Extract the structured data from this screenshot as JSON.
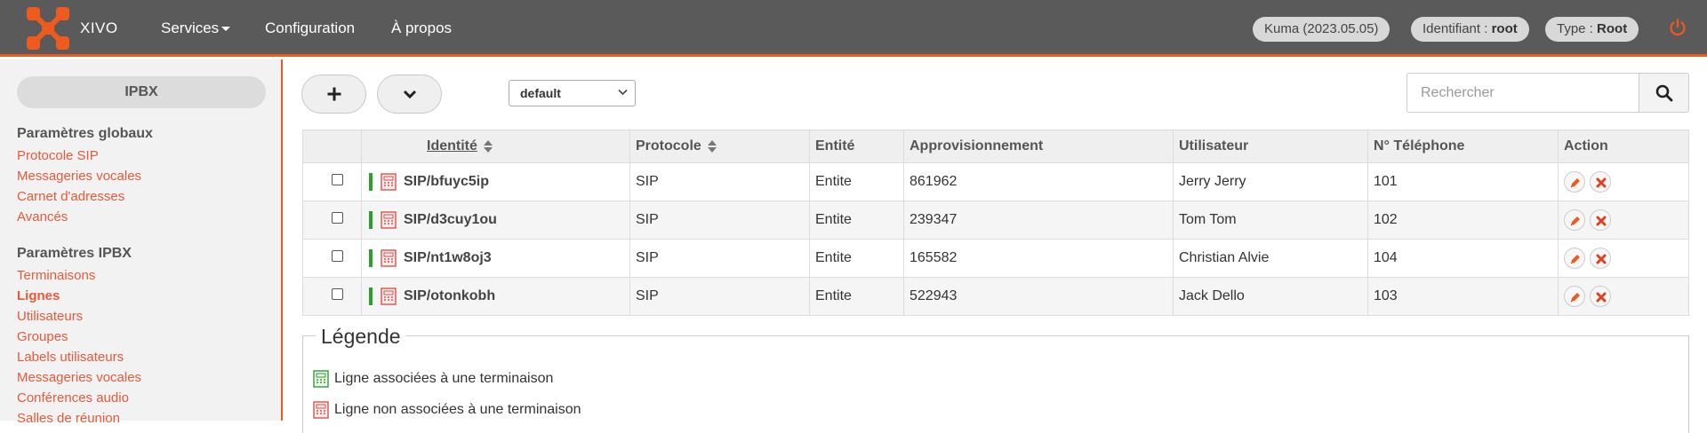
{
  "brand": "XIVO",
  "nav": {
    "services": "Services",
    "configuration": "Configuration",
    "about": "À propos"
  },
  "status": {
    "version": "Kuma (2023.05.05)",
    "login_label": "Identifiant :",
    "login_value": "root",
    "type_label": "Type :",
    "type_value": "Root"
  },
  "sidebar": {
    "title": "IPBX",
    "global_section": "Paramètres globaux",
    "global_items": [
      "Protocole SIP",
      "Messageries vocales",
      "Carnet d'adresses",
      "Avancés"
    ],
    "ipbx_section": "Paramètres IPBX",
    "ipbx_items": [
      "Terminaisons",
      "Lignes",
      "Utilisateurs",
      "Groupes",
      "Labels utilisateurs",
      "Messageries vocales",
      "Conférences audio",
      "Salles de réunion"
    ],
    "active_item": "Lignes"
  },
  "toolbar": {
    "add_icon": "plus-icon",
    "expand_icon": "chevron-down-icon",
    "context_select": "default",
    "search_placeholder": "Rechercher"
  },
  "table": {
    "headers": {
      "identity": "Identité",
      "protocol": "Protocole",
      "entity": "Entité",
      "provisioning": "Approvisionnement",
      "user": "Utilisateur",
      "phone": "N° Téléphone",
      "action": "Action"
    },
    "rows": [
      {
        "identity": "SIP/bfuyc5ip",
        "protocol": "SIP",
        "entity": "Entite",
        "provisioning": "861962",
        "user": "Jerry Jerry",
        "phone": "101"
      },
      {
        "identity": "SIP/d3cuy1ou",
        "protocol": "SIP",
        "entity": "Entite",
        "provisioning": "239347",
        "user": "Tom Tom",
        "phone": "102"
      },
      {
        "identity": "SIP/nt1w8oj3",
        "protocol": "SIP",
        "entity": "Entite",
        "provisioning": "165582",
        "user": "Christian Alvie",
        "phone": "104"
      },
      {
        "identity": "SIP/otonkobh",
        "protocol": "SIP",
        "entity": "Entite",
        "provisioning": "522943",
        "user": "Jack Dello",
        "phone": "103"
      }
    ]
  },
  "legend": {
    "title": "Légende",
    "associated": "Ligne associées à une terminaison",
    "not_associated": "Ligne non associées à une terminaison"
  },
  "colors": {
    "accent": "#ef5a1f",
    "topbar": "#5a5a5a",
    "link": "#e8593a",
    "status_green": "#2aa02a"
  }
}
